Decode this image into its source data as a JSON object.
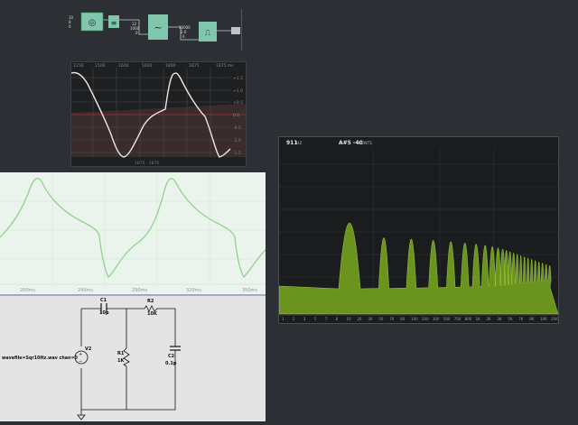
{
  "node_graph": {
    "nodes": [
      {
        "id": "node-osc",
        "glyph": "◎",
        "inputs": [
          "10",
          "8",
          "0"
        ]
      },
      {
        "id": "node-small",
        "glyph": "≡",
        "inputs": []
      },
      {
        "id": "node-filter",
        "glyph": "~",
        "inputs": [
          "12",
          "1000",
          "0"
        ]
      },
      {
        "id": "node-out",
        "glyph": "⎍",
        "inputs": [
          "10000",
          "2.0",
          "0"
        ]
      }
    ]
  },
  "oscilloscope": {
    "top_ticks": [
      "1250",
      "1500",
      "1600",
      "1600",
      "1800",
      "1875",
      "1875 ms"
    ],
    "right_ticks": [
      "+1.5",
      "+1.0",
      "+0.5",
      "0.0",
      "-0.5",
      "-1.0",
      "-1.5"
    ],
    "footer": "1875 · 1875"
  },
  "waveform_panel": {
    "time_ticks": [
      "200ms",
      "240ms",
      "290ms",
      "320ms",
      "350ms"
    ]
  },
  "circuit": {
    "components": {
      "c1_name": "C1",
      "c1_value": "10p",
      "r2_name": "R2",
      "r2_value": "10K",
      "v2_name": "V2",
      "r1_name": "R1",
      "r1_value": "1K",
      "c2_name": "C2",
      "c2_value": "0.1p"
    },
    "source_label": "wavefile=Sqr10Hz.wav chan=0"
  },
  "spectrum": {
    "header_left": "911",
    "header_left_unit": "HZ",
    "header_note": "A#5 -40",
    "header_note_unit": "CENTS",
    "freq_ticks": [
      "1",
      "2",
      "3",
      "5",
      "7",
      "8",
      "10",
      "20",
      "30",
      "50",
      "70",
      "80",
      "100",
      "200",
      "300",
      "500",
      "700",
      "800",
      "1K",
      "2K",
      "3K",
      "5K",
      "7K",
      "8K",
      "10K",
      "20K"
    ]
  }
}
